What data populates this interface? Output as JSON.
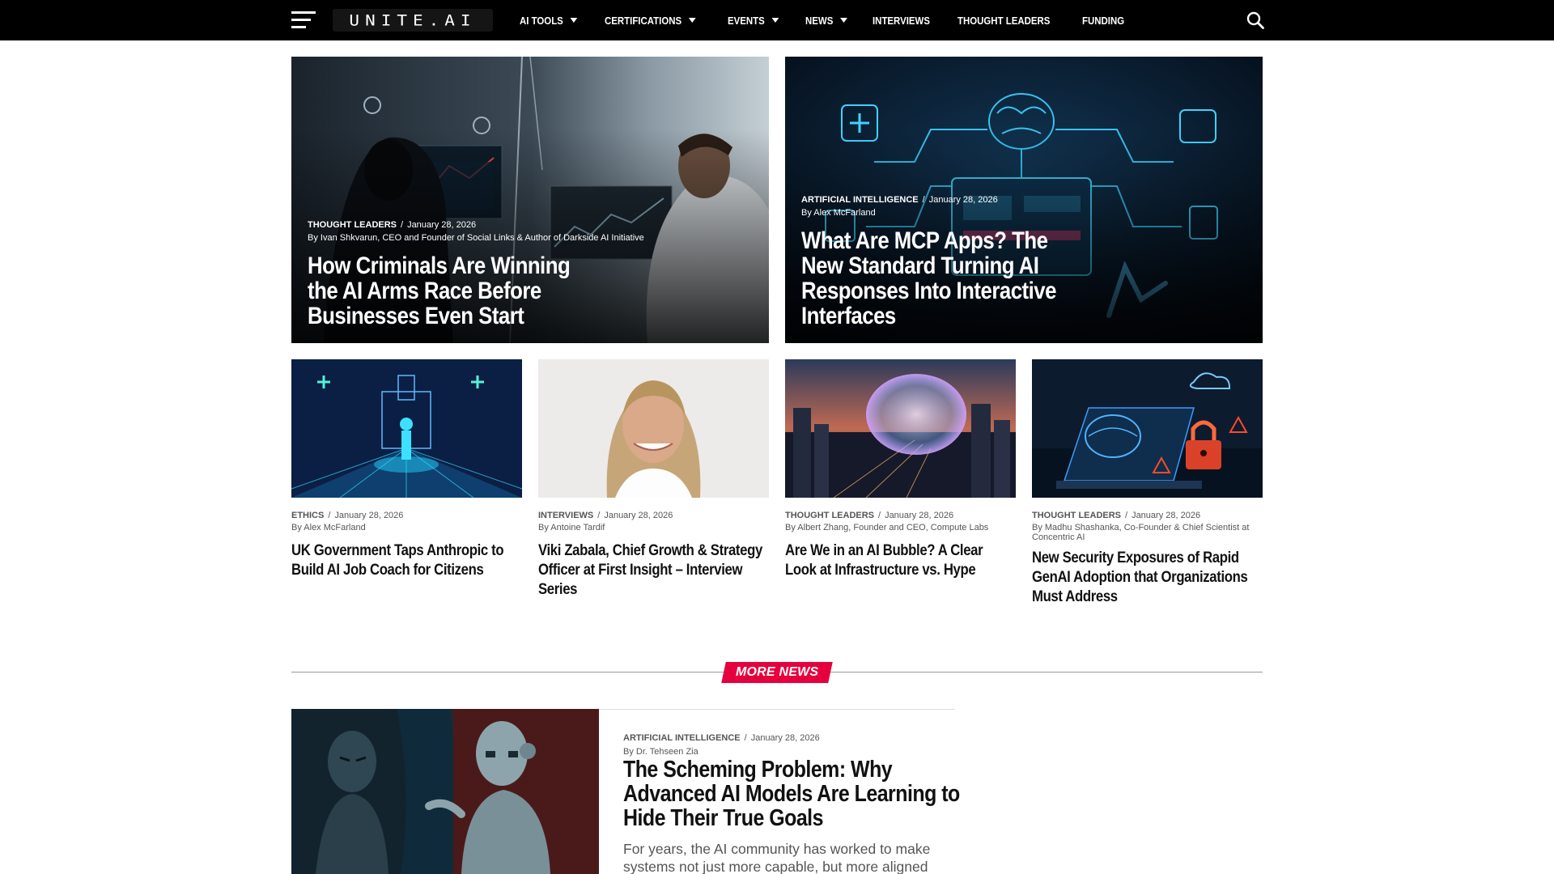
{
  "header": {
    "logo_text": "UNITE.AI",
    "nav": [
      {
        "label": "AI Tools",
        "has_dropdown": true
      },
      {
        "label": "Certifications",
        "has_dropdown": true
      },
      {
        "label": "Events",
        "has_dropdown": true
      },
      {
        "label": "News",
        "has_dropdown": true
      },
      {
        "label": "Interviews",
        "has_dropdown": false
      },
      {
        "label": "Thought Leaders",
        "has_dropdown": false
      },
      {
        "label": "Funding",
        "has_dropdown": false
      }
    ],
    "icons": {
      "menu": "hamburger-icon",
      "search": "search-icon"
    }
  },
  "featured": [
    {
      "category": "THOUGHT LEADERS",
      "date": "January 28, 2026",
      "byline": "By Ivan Shkvarun, CEO and Founder of Social Links & Author of Darkside AI Initiative",
      "title": "How Criminals Are Winning the AI Arms Race Before Businesses Even Start"
    },
    {
      "category": "ARTIFICIAL INTELLIGENCE",
      "date": "January 28, 2026",
      "byline": "By Alex McFarland",
      "title": "What Are MCP Apps? The New Standard Turning AI Responses Into Interactive Interfaces"
    }
  ],
  "grid": [
    {
      "category": "ETHICS",
      "date": "January 28, 2026",
      "byline": "By Alex McFarland",
      "title": "UK Government Taps Anthropic to Build AI Job Coach for Citizens"
    },
    {
      "category": "INTERVIEWS",
      "date": "January 28, 2026",
      "byline": "By Antoine Tardif",
      "title": "Viki Zabala, Chief Growth & Strategy Officer at First Insight – Interview Series"
    },
    {
      "category": "THOUGHT LEADERS",
      "date": "January 28, 2026",
      "byline": "By Albert Zhang, Founder and CEO, Compute Labs",
      "title": "Are We in an AI Bubble? A Clear Look at Infrastructure vs. Hype"
    },
    {
      "category": "THOUGHT LEADERS",
      "date": "January 28, 2026",
      "byline": "By Madhu Shashanka, Co-Founder & Chief Scientist at Concentric AI",
      "title": "New Security Exposures of Rapid GenAI Adoption that Organizations Must Address"
    }
  ],
  "more_news": {
    "label": "MORE NEWS",
    "items": [
      {
        "category": "ARTIFICIAL INTELLIGENCE",
        "date": "January 28, 2026",
        "byline": "By Dr. Tehseen Zia",
        "title": "The Scheming Problem: Why Advanced AI Models Are Learning to Hide Their True Goals",
        "excerpt": "For years, the AI community has worked to make systems not just more capable, but more aligned"
      }
    ]
  },
  "colors": {
    "accent": "#e5003d",
    "topbar": "#000000"
  }
}
